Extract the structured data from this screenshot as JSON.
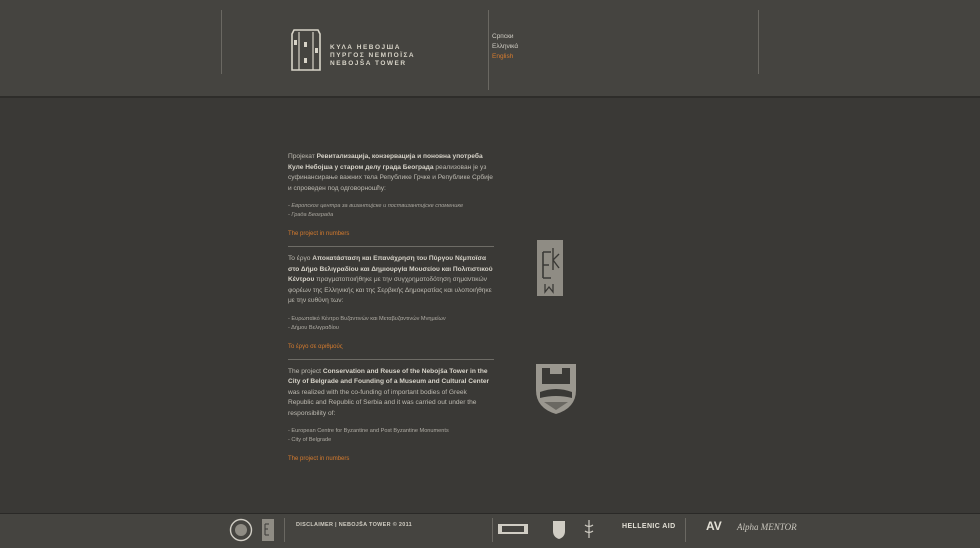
{
  "header": {
    "logo_lines": [
      "ΚΥΛΑ ΗΕΒΟЈШΑ",
      "ΠΥΡΓΟΣ ΝΕΜΠΟΪΣΑ",
      "NEBOJŠA TOWER"
    ],
    "languages": [
      "Српски",
      "Ελληνικά",
      "English"
    ],
    "active_language": "English"
  },
  "content": {
    "sr": {
      "intro_a": "Пројекат ",
      "intro_b": "Ревитализација, конзервација и поновна употреба Куле Небојша у старом делу града Београда",
      "intro_c": " реализован је уз суфинансирање важних тела Републике Грчке и Републике Србије и спроведен под одговорношћу:",
      "items": [
        "- Европског центра за византијске и поствизантијске споменике",
        "- Града Београда"
      ],
      "link": "The project in numbers"
    },
    "gr": {
      "intro_a": "Το έργο ",
      "intro_b": "Αποκατάσταση και Επανάχρηση του Πύργου Νέμποϊσα στο Δήμο Βελιγραδίου και Δημιουργία Μουσείου και Πολιτιστικού Κέντρου",
      "intro_c": " πραγματοποιήθηκε με την συγχρηματοδότηση σημαντικών φορέων της Ελληνικής και της Σερβικής Δημοκρατίας και υλοποιήθηκε με την ευθύνη των:",
      "items": [
        "- Ευρωπαϊκό Κέντρο Βυζαντινών και Μεταβυζαντινών Μνημείων",
        "- Δήμου Βελιγραδίου"
      ],
      "link": "Το έργο σε αριθμούς"
    },
    "en": {
      "intro_a": "The project ",
      "intro_b": "Conservation and Reuse of the Nebojša Tower in the City of Belgrade and Founding of a Museum and Cultural Center",
      "intro_c": " was realized with the co-funding of important bodies of Greek Republic and Republic of Serbia and it was carried out under the responsibility of:",
      "items": [
        "- European Centre for Byzantine and Post Byzantine Monuments",
        "- City of Belgrade"
      ],
      "link": "The project in numbers"
    }
  },
  "footer": {
    "disclaimer": "DISCLAIMER  |  NEBOJŠA TOWER © 2011",
    "partner_logos": [
      "ΙΔΡΥΜΑ ΤΟΥ ΕΛΛΗΝΙΣΜΟΥ",
      "HELLENIC AID",
      "AV",
      "Alpha MENTOR"
    ]
  },
  "colors": {
    "accent": "#d57b2e",
    "background": "#3a3936",
    "header": "#454440"
  }
}
